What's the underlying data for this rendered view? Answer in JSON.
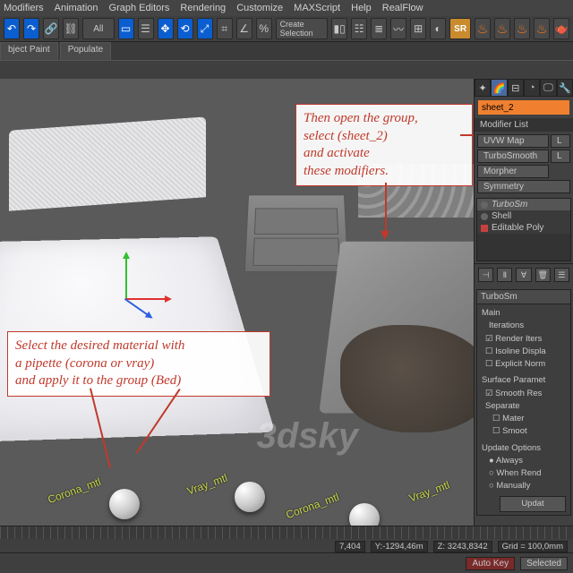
{
  "menu": [
    "Modifiers",
    "Animation",
    "Graph Editors",
    "Rendering",
    "Customize",
    "MAXScript",
    "Help",
    "RealFlow"
  ],
  "tool": {
    "dropdown": "All",
    "create_sel": "Create Selection",
    "sr": "SR"
  },
  "tabs": {
    "object_paint": "bject Paint",
    "populate": "Populate"
  },
  "viewport": {
    "materials": [
      {
        "label": "Corona_mtl"
      },
      {
        "label": "Vray_mtl"
      },
      {
        "label": "Corona_mtl"
      },
      {
        "label": "Vray_mtl"
      }
    ],
    "watermark": "3dsky"
  },
  "annotations": {
    "top": "Then open the group,\nselect (sheet_2)\nand activate\nthese modifiers.",
    "bottom": "Select the desired material with\na pipette (corona or vray)\nand apply it to the group (Bed)"
  },
  "panel": {
    "object_name": "sheet_2",
    "modifier_list_label": "Modifier List",
    "buttons": [
      "UVW Map",
      "L",
      "TurboSmooth",
      "L",
      "Morpher",
      "Symmetry"
    ],
    "stack": [
      {
        "name": "TurboSm",
        "enabled": false,
        "icon": "bulb"
      },
      {
        "name": "Shell",
        "enabled": false,
        "icon": "bulb"
      },
      {
        "name": "Editable Poly",
        "enabled": true,
        "icon": "square"
      }
    ],
    "rollout_title": "TurboSm",
    "main_label": "Main",
    "iterations_label": "Iterations",
    "render_iters": "Render Iters",
    "isoline": "Isoline Displa",
    "explicit": "Explicit Norm",
    "surface_params": "Surface Paramet",
    "smooth_res": "Smooth Res",
    "separate": "Separate",
    "sep_mater": "Mater",
    "sep_smoot": "Smoot",
    "update_options": "Update Options",
    "always": "Always",
    "when_rend": "When Rend",
    "manually": "Manually",
    "update_btn": "Updat"
  },
  "status": {
    "objcount": "7,404",
    "y": "Y:-1294,46m",
    "z": "Z: 3243,8342",
    "grid": "Grid = 100,0mm",
    "autokey": "Auto Key",
    "selected": "Selected"
  }
}
